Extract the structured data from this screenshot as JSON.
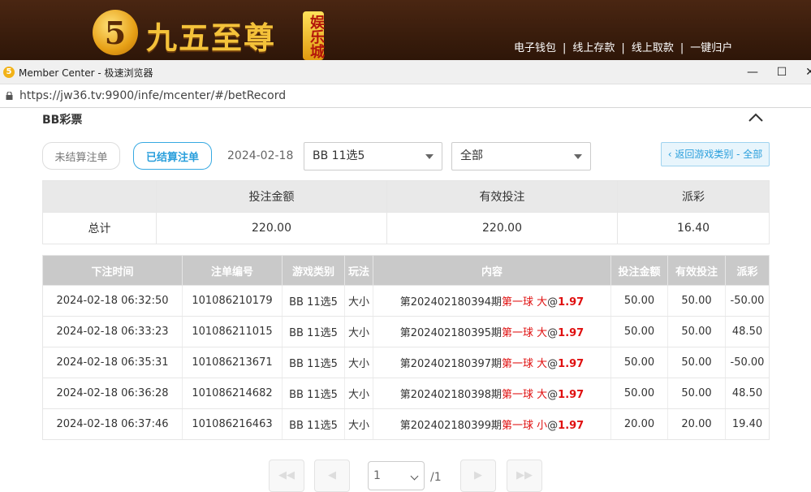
{
  "site": {
    "logo_glyph": "5",
    "logo_text": "九五至尊",
    "logo_badge": "娱乐城",
    "links": [
      "电子钱包",
      "线上存款",
      "线上取款",
      "一键归户"
    ]
  },
  "window": {
    "title": "Member Center - 极速浏览器",
    "url": "https://jw36.tv:9900/infe/mcenter/#/betRecord",
    "controls": [
      "—",
      "☐",
      "✕"
    ]
  },
  "section": {
    "title": "BB彩票"
  },
  "filters": {
    "unsettled_label": "未结算注单",
    "settled_label": "已结算注单",
    "date": "2024-02-18",
    "game_select": "BB 11选5",
    "type_select": "全部",
    "back_label": "‹ 返回游戏类别 - 全部"
  },
  "summary": {
    "headers": [
      "投注金额",
      "有效投注",
      "派彩"
    ],
    "total_label": "总计",
    "values": [
      "220.00",
      "220.00",
      "16.40"
    ]
  },
  "bets": {
    "headers": [
      "下注时间",
      "注单编号",
      "游戏类别",
      "玩法",
      "内容",
      "投注金额",
      "有效投注",
      "派彩"
    ],
    "rows": [
      {
        "time": "2024-02-18 06:32:50",
        "id": "101086210179",
        "game": "BB 11选5",
        "play": "大小",
        "period": "第202402180394期",
        "pick": "第一球 大",
        "at": "@",
        "odds": "1.97",
        "amount": "50.00",
        "valid": "50.00",
        "payout": "-50.00",
        "neg": true
      },
      {
        "time": "2024-02-18 06:33:23",
        "id": "101086211015",
        "game": "BB 11选5",
        "play": "大小",
        "period": "第202402180395期",
        "pick": "第一球 大",
        "at": "@",
        "odds": "1.97",
        "amount": "50.00",
        "valid": "50.00",
        "payout": "48.50",
        "neg": false
      },
      {
        "time": "2024-02-18 06:35:31",
        "id": "101086213671",
        "game": "BB 11选5",
        "play": "大小",
        "period": "第202402180397期",
        "pick": "第一球 大",
        "at": "@",
        "odds": "1.97",
        "amount": "50.00",
        "valid": "50.00",
        "payout": "-50.00",
        "neg": true
      },
      {
        "time": "2024-02-18 06:36:28",
        "id": "101086214682",
        "game": "BB 11选5",
        "play": "大小",
        "period": "第202402180398期",
        "pick": "第一球 大",
        "at": "@",
        "odds": "1.97",
        "amount": "50.00",
        "valid": "50.00",
        "payout": "48.50",
        "neg": false
      },
      {
        "time": "2024-02-18 06:37:46",
        "id": "101086216463",
        "game": "BB 11选5",
        "play": "大小",
        "period": "第202402180399期",
        "pick": "第一球 小",
        "at": "@",
        "odds": "1.97",
        "amount": "20.00",
        "valid": "20.00",
        "payout": "19.40",
        "neg": false
      }
    ]
  },
  "pagination": {
    "first": "◀◀",
    "prev": "◀",
    "page": "1",
    "total": "/1",
    "next": "▶",
    "last": "▶▶"
  },
  "colors": {
    "accent": "#2a9fdc",
    "negative": "#e84c4c",
    "highlight": "#e01010",
    "header_bg": "#3a1d0c"
  }
}
